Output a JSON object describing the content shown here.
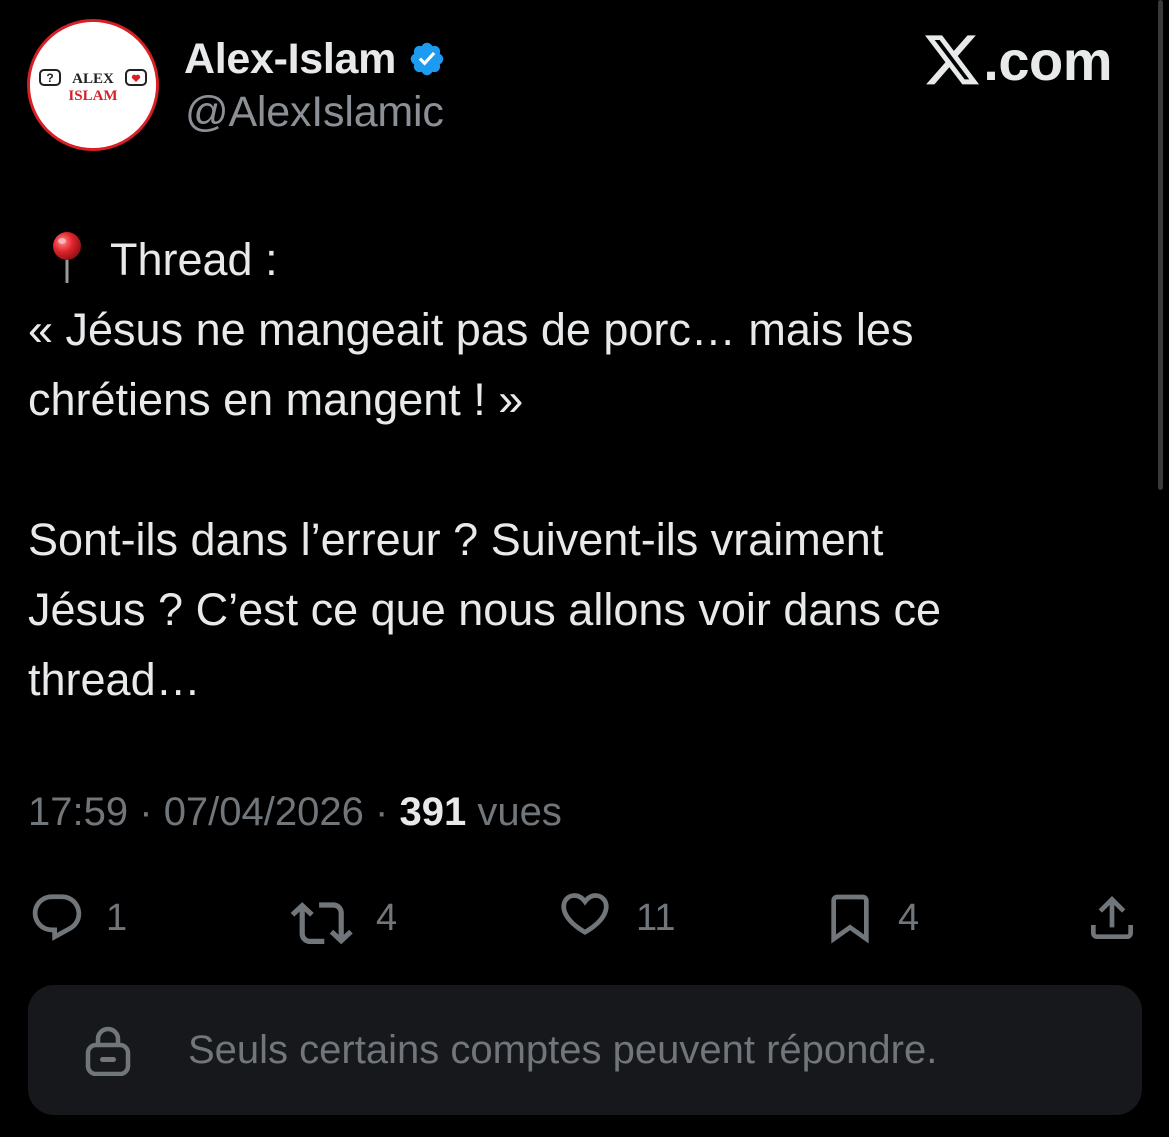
{
  "author": {
    "display_name": "Alex-Islam",
    "handle": "@AlexIslamic",
    "avatar_text_top": "ALEX",
    "avatar_text_bottom": "ISLAM",
    "verified": true
  },
  "brand": {
    "label": ".com",
    "icon": "x-logo-icon"
  },
  "tweet": {
    "lines": [
      "Thread :",
      "« Jésus ne mangeait pas de porc… mais les",
      "chrétiens en mangent ! »",
      "Sont-ils dans l’erreur ? Suivent-ils vraiment",
      "Jésus ?  C’est ce que nous allons voir dans ce",
      "thread…"
    ],
    "lead_icon": "round-pushpin-icon"
  },
  "meta": {
    "time": "17:59",
    "separator": "·",
    "date": "07/04/2026",
    "views_count": "391",
    "views_label": "vues"
  },
  "actions": {
    "replies": "1",
    "reposts": "4",
    "likes": "11",
    "bookmarks": "4"
  },
  "reply_restriction": {
    "message": "Seuls certains comptes peuvent répondre.",
    "icon": "lock-icon"
  },
  "colors": {
    "background": "#000000",
    "primary_text": "#e7e9ea",
    "secondary_text": "#71767b",
    "verified_badge": "#1d9bf0",
    "avatar_red": "#d71f26",
    "restricted_box": "#16181c"
  }
}
